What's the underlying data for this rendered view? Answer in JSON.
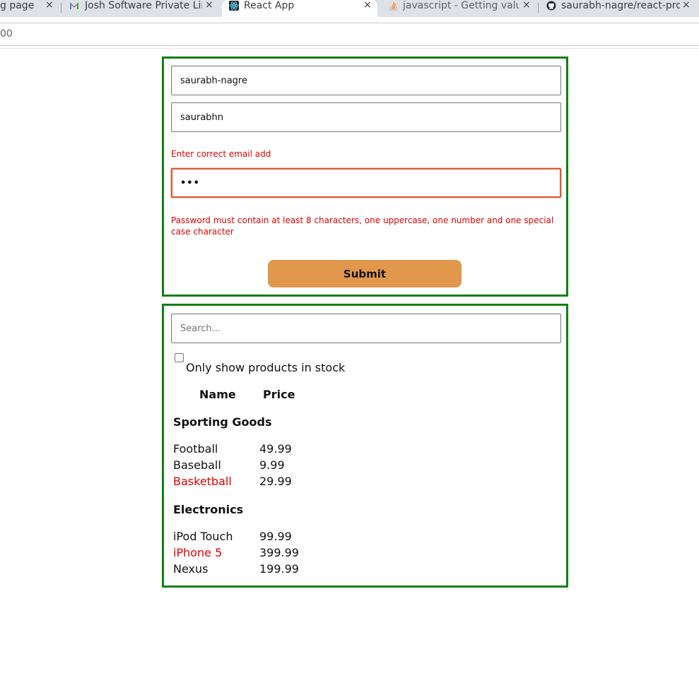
{
  "browser": {
    "tabs": [
      {
        "title": "g page",
        "active": false
      },
      {
        "title": "Josh Software Private Lin",
        "active": false,
        "icon": "gmail-icon"
      },
      {
        "title": "React App",
        "active": true,
        "icon": "react-icon"
      },
      {
        "title": "javascript - Getting value",
        "active": false,
        "icon": "stackoverflow-icon"
      },
      {
        "title": "saurabh-nagre/react-proj",
        "active": false,
        "icon": "github-icon"
      }
    ],
    "close_glyph": "×",
    "url_fragment": "00"
  },
  "form": {
    "username_value": "saurabh-nagre",
    "email_value": "saurabhn",
    "email_error": "Enter correct email add",
    "password_value": "•••",
    "password_error_line1": "Password must contain at least 8 characters, one uppercase, one number and one special",
    "password_error_line2": "case character",
    "submit_label": "Submit",
    "border_color": "#118013",
    "button_color": "#e1974c",
    "error_color": "#e00000"
  },
  "products": {
    "search_placeholder": "Search...",
    "in_stock_label": "Only show products in stock",
    "in_stock_checked": false,
    "headers": {
      "name": "Name",
      "price": "Price"
    },
    "categories": [
      {
        "name": "Sporting Goods",
        "items": [
          {
            "name": "Football",
            "price": "49.99",
            "stocked": true
          },
          {
            "name": "Baseball",
            "price": "9.99",
            "stocked": true
          },
          {
            "name": "Basketball",
            "price": "29.99",
            "stocked": false
          }
        ]
      },
      {
        "name": "Electronics",
        "items": [
          {
            "name": "iPod Touch",
            "price": "99.99",
            "stocked": true
          },
          {
            "name": "iPhone 5",
            "price": "399.99",
            "stocked": false
          },
          {
            "name": "Nexus",
            "price": "199.99",
            "stocked": true
          }
        ]
      }
    ]
  }
}
